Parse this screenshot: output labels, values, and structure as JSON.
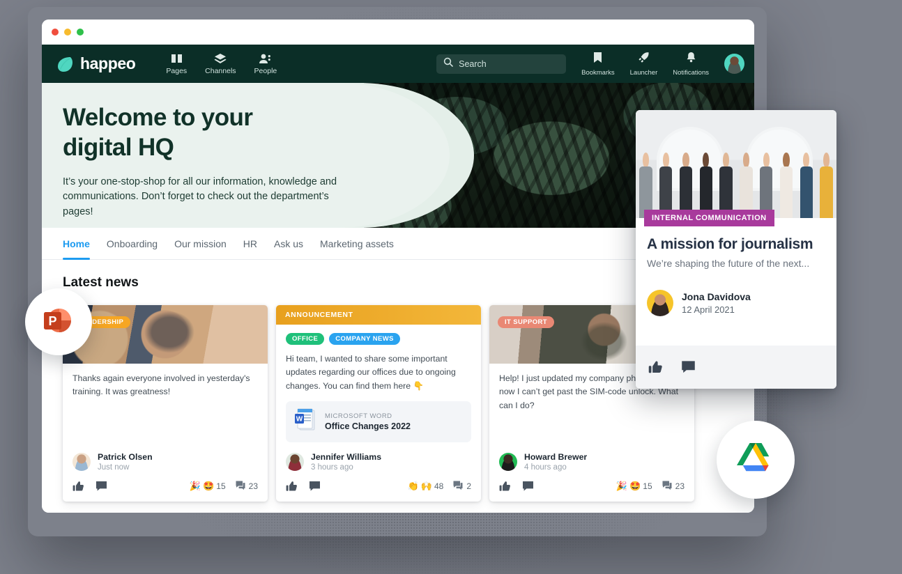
{
  "window": {
    "traffic_lights": [
      "close",
      "minimize",
      "maximize"
    ]
  },
  "navbar": {
    "brand": "happeo",
    "items": [
      {
        "label": "Pages",
        "icon": "book-icon"
      },
      {
        "label": "Channels",
        "icon": "layers-icon"
      },
      {
        "label": "People",
        "icon": "people-icon"
      }
    ],
    "search": {
      "placeholder": "Search",
      "value": "",
      "icon": "search-icon"
    },
    "utils": [
      {
        "label": "Bookmarks",
        "icon": "bookmark-icon"
      },
      {
        "label": "Launcher",
        "icon": "rocket-icon"
      },
      {
        "label": "Notifications",
        "icon": "bell-icon"
      }
    ],
    "avatar": "user-avatar"
  },
  "hero": {
    "title_line1": "Welcome to your",
    "title_line2": "digital HQ",
    "subtitle": "It’s your one-stop-shop for all our information, knowledge and communications. Don’t forget to check out the department’s pages!"
  },
  "tabs": [
    {
      "label": "Home",
      "active": true
    },
    {
      "label": "Onboarding",
      "active": false
    },
    {
      "label": "Our mission",
      "active": false
    },
    {
      "label": "HR",
      "active": false
    },
    {
      "label": "Ask us",
      "active": false
    },
    {
      "label": "Marketing assets",
      "active": false
    }
  ],
  "main": {
    "section_title": "Latest news"
  },
  "cards": [
    {
      "chip": "LEADERSHIP",
      "chip_color": "#f6a623",
      "text": "Thanks again everyone involved in yesterday's training. It was greatness!",
      "author": "Patrick Olsen",
      "time": "Just now",
      "reactions": [
        {
          "emoji": "🎉",
          "name": "party-popper-emoji"
        },
        {
          "emoji": "🤩",
          "name": "star-struck-emoji"
        }
      ],
      "reaction_count": "15",
      "comment_count": "23"
    },
    {
      "banner": "ANNOUNCEMENT",
      "banner_color": "#e8a01e",
      "tags": [
        {
          "label": "OFFICE",
          "color": "#1fc07a"
        },
        {
          "label": "COMPANY NEWS",
          "color": "#2aa3ef"
        }
      ],
      "text": "Hi team, I wanted to share some important updates regarding our offices due to ongoing changes. You can find them here 👇",
      "attachment": {
        "kind": "MICROSOFT WORD",
        "name": "Office Changes 2022",
        "icon": "word-document-icon"
      },
      "author": "Jennifer Williams",
      "time": "3 hours ago",
      "reactions": [
        {
          "emoji": "👏",
          "name": "clapping-hands-emoji"
        },
        {
          "emoji": "🙌",
          "name": "raising-hands-emoji"
        }
      ],
      "reaction_count": "48",
      "comment_count": "2"
    },
    {
      "chip": "IT SUPPORT",
      "chip_color": "#e98874",
      "text": "Help! I just updated my company phone and now I can’t get past the SIM-code unlock. What can I do?",
      "author": "Howard Brewer",
      "time": "4 hours ago",
      "reactions": [
        {
          "emoji": "🎉",
          "name": "party-popper-emoji"
        },
        {
          "emoji": "🤩",
          "name": "star-struck-emoji"
        }
      ],
      "reaction_count": "15",
      "comment_count": "23"
    }
  ],
  "float_card": {
    "category": "INTERNAL COMMUNICATION",
    "category_color": "#a83a9c",
    "title": "A mission for journalism",
    "subtitle": "We’re shaping the future of the next...",
    "author": "Jona Davidova",
    "date": "12 April 2021",
    "like_icon": "thumbs-up-icon",
    "comment_icon": "comment-icon"
  },
  "bubbles": [
    {
      "name": "powerpoint-icon",
      "label": "PowerPoint"
    },
    {
      "name": "google-drive-icon",
      "label": "Google Drive"
    }
  ],
  "colors": {
    "nav_bg": "#0b2e27",
    "brand_mint": "#4fd6c0",
    "accent_blue": "#1d9bf0",
    "hero_bg": "#e4efe9",
    "page_bg": "#7d818b"
  }
}
